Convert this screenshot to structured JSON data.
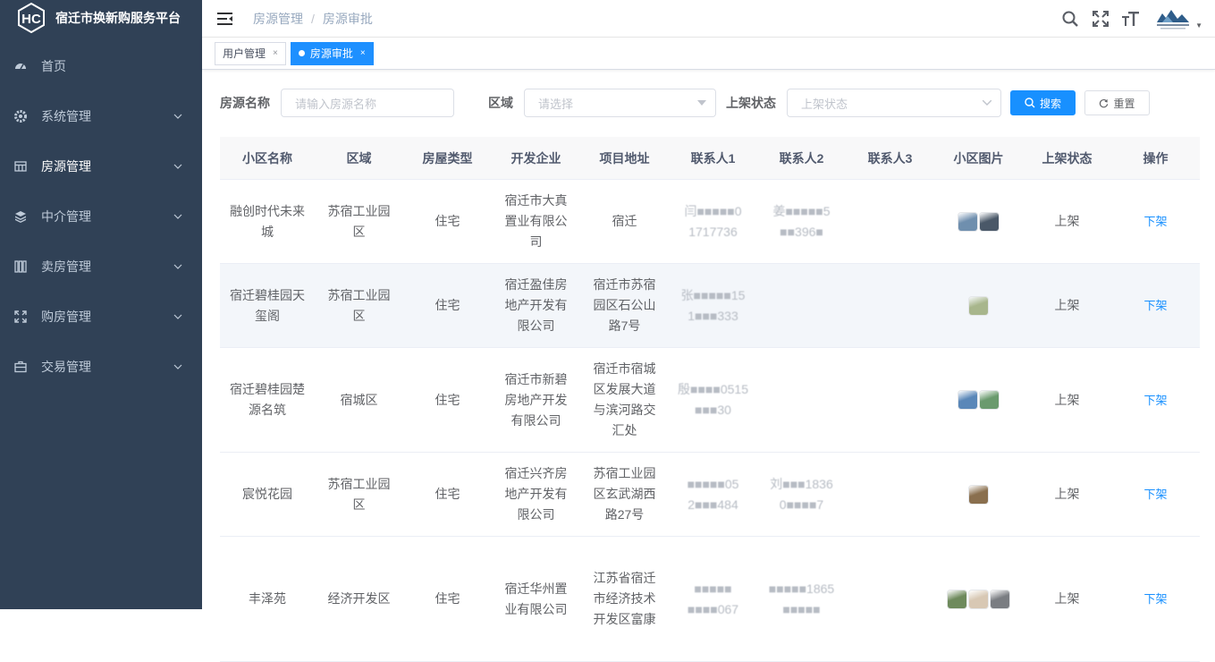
{
  "app": {
    "title": "宿迁市换新购服务平台"
  },
  "sidebar": {
    "items": [
      {
        "label": "首页",
        "icon": "dashboard-icon",
        "chevron": false
      },
      {
        "label": "系统管理",
        "icon": "gear-icon",
        "chevron": true
      },
      {
        "label": "房源管理",
        "icon": "grid-icon",
        "chevron": true,
        "active": true
      },
      {
        "label": "中介管理",
        "icon": "layers-icon",
        "chevron": true
      },
      {
        "label": "卖房管理",
        "icon": "columns-icon",
        "chevron": true
      },
      {
        "label": "购房管理",
        "icon": "expand-icon",
        "chevron": true
      },
      {
        "label": "交易管理",
        "icon": "briefcase-icon",
        "chevron": true
      }
    ]
  },
  "navbar": {
    "breadcrumb": [
      "房源管理",
      "房源审批"
    ],
    "icons": [
      "search-icon",
      "fullscreen-icon",
      "font-size-icon"
    ]
  },
  "tags": [
    {
      "label": "用户管理",
      "active": false
    },
    {
      "label": "房源审批",
      "active": true
    }
  ],
  "search": {
    "name_label": "房源名称",
    "name_placeholder": "请输入房源名称",
    "area_label": "区域",
    "area_placeholder": "请选择",
    "status_label": "上架状态",
    "status_placeholder": "上架状态",
    "search_button": "搜索",
    "reset_button": "重置"
  },
  "table": {
    "headers": [
      "小区名称",
      "区域",
      "房屋类型",
      "开发企业",
      "项目地址",
      "联系人1",
      "联系人2",
      "联系人3",
      "小区图片",
      "上架状态",
      "操作"
    ],
    "rows": [
      {
        "name": "融创时代未来城",
        "area": "苏宿工业园区",
        "type": "住宅",
        "developer": "宿迁市大真置业有限公司",
        "address": "宿迁",
        "contact1": "闫■■■■■0 1717736",
        "contact2": "姜■■■■■5 ■■396■",
        "contact3": "",
        "images": [
          "#6f8fae",
          "#4a5868"
        ],
        "status": "上架",
        "action": "下架"
      },
      {
        "name": "宿迁碧桂园天玺阁",
        "area": "苏宿工业园区",
        "type": "住宅",
        "developer": "宿迁盈佳房地产开发有限公司",
        "address": "宿迁市苏宿园区石公山路7号",
        "contact1": "张■■■■■15 1■■■333",
        "contact2": "",
        "contact3": "",
        "images": [
          "#a8b68c"
        ],
        "status": "上架",
        "action": "下架"
      },
      {
        "name": "宿迁碧桂园楚源名筑",
        "area": "宿城区",
        "type": "住宅",
        "developer": "宿迁市新碧房地产开发有限公司",
        "address": "宿迁市宿城区发展大道与滨河路交汇处",
        "contact1": "殷■■■■0515 ■■■30",
        "contact2": "",
        "contact3": "",
        "images": [
          "#5a87b8",
          "#6a9a6e"
        ],
        "status": "上架",
        "action": "下架"
      },
      {
        "name": "宸悦花园",
        "area": "苏宿工业园区",
        "type": "住宅",
        "developer": "宿迁兴齐房地产开发有限公司",
        "address": "苏宿工业园区玄武湖西路27号",
        "contact1": "■■■■■05 2■■■484",
        "contact2": "刘■■■1836 0■■■■7",
        "contact3": "",
        "images": [
          "#8a6f4e"
        ],
        "status": "上架",
        "action": "下架"
      },
      {
        "name": "丰泽苑",
        "area": "经济开发区",
        "type": "住宅",
        "developer": "宿迁华州置业有限公司",
        "address": "江苏省宿迁市经济技术开发区富康",
        "contact1": "■■■■■ ■■■■067",
        "contact2": "■■■■■1865 ■■■■■",
        "contact3": "",
        "images": [
          "#6e8a5c",
          "#d8c8b4",
          "#7a7d82"
        ],
        "status": "上架",
        "action": "下架"
      }
    ]
  }
}
